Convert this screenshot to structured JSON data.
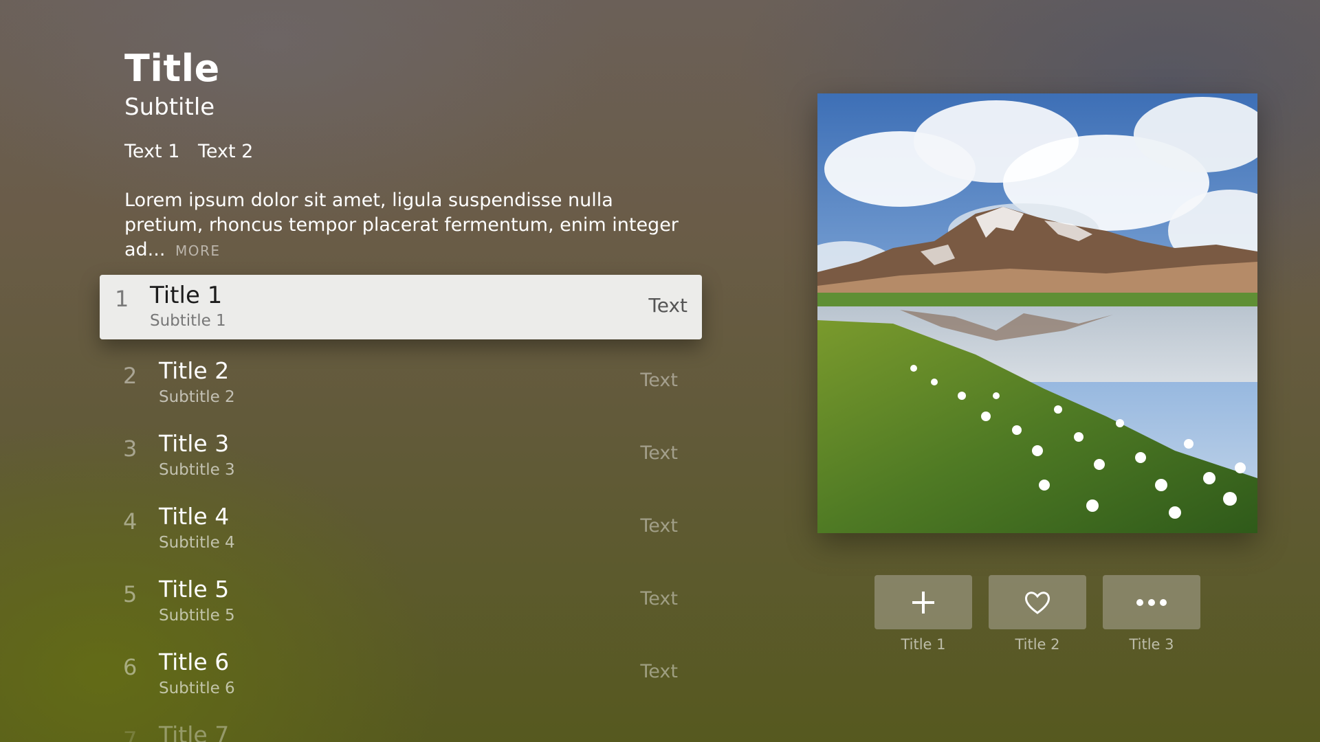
{
  "header": {
    "title": "Title",
    "subtitle": "Subtitle",
    "meta": [
      "Text 1",
      "Text 2"
    ],
    "description": "Lorem ipsum dolor sit amet, ligula suspendisse nulla pretium, rhoncus tempor placerat fermentum, enim integer ad...",
    "more_label": "MORE"
  },
  "list": {
    "items": [
      {
        "number": "1",
        "title": "Title 1",
        "subtitle": "Subtitle 1",
        "text": "Text",
        "focused": true
      },
      {
        "number": "2",
        "title": "Title 2",
        "subtitle": "Subtitle 2",
        "text": "Text"
      },
      {
        "number": "3",
        "title": "Title 3",
        "subtitle": "Subtitle 3",
        "text": "Text"
      },
      {
        "number": "4",
        "title": "Title 4",
        "subtitle": "Subtitle 4",
        "text": "Text"
      },
      {
        "number": "5",
        "title": "Title 5",
        "subtitle": "Subtitle 5",
        "text": "Text"
      },
      {
        "number": "6",
        "title": "Title 6",
        "subtitle": "Subtitle 6",
        "text": "Text"
      },
      {
        "number": "7",
        "title": "Title 7"
      }
    ]
  },
  "artwork": {
    "icon": "landscape-photo"
  },
  "actions": [
    {
      "label": "Title 1",
      "icon": "plus-icon"
    },
    {
      "label": "Title 2",
      "icon": "heart-icon"
    },
    {
      "label": "Title 3",
      "icon": "more-icon"
    }
  ]
}
